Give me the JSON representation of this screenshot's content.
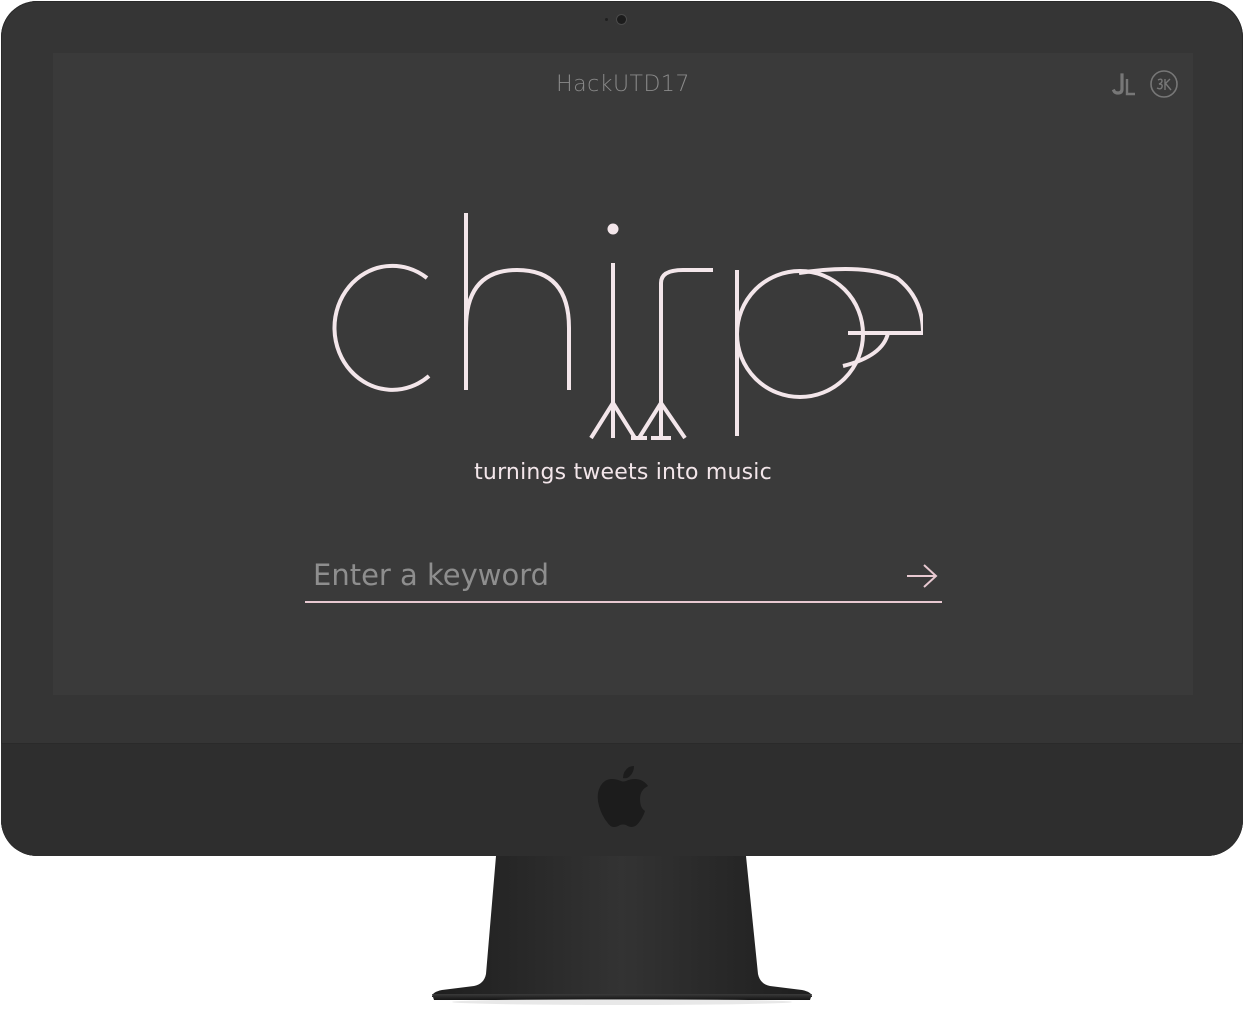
{
  "header": {
    "site_name": "HackUTD17",
    "icons": [
      "jl-monogram-icon",
      "circle-monogram-icon"
    ]
  },
  "hero": {
    "logo_text": "chirp",
    "tagline": "turnings tweets into music"
  },
  "search": {
    "placeholder": "Enter a keyword",
    "value": "",
    "submit_icon": "arrow-right-icon"
  },
  "colors": {
    "screen_bg": "#3a3a3a",
    "monitor_bezel": "#353535",
    "accent_pink": "#f3e6ea",
    "underline": "#e8c9d1",
    "muted_text": "#8a8a8a"
  }
}
